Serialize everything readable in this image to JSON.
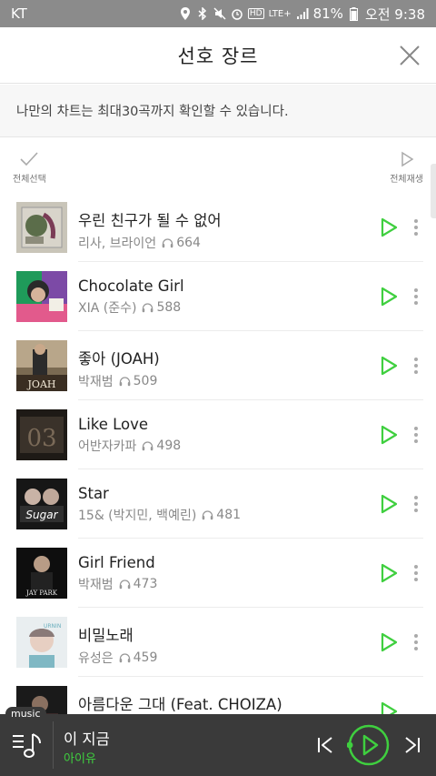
{
  "statusbar": {
    "carrier": "KT",
    "lte": "LTE+",
    "hd": "HD",
    "battery": "81%",
    "time": "오전 9:38"
  },
  "header": {
    "title": "선호 장르"
  },
  "notice": "나만의 차트는 최대30곡까지 확인할 수 있습니다.",
  "actions": {
    "select_all": "전체선택",
    "play_all": "전체재생"
  },
  "songs": [
    {
      "title": "우린 친구가 될 수 없어",
      "artist": "리사, 브라이언",
      "plays": "664"
    },
    {
      "title": "Chocolate Girl",
      "artist": "XIA (준수)",
      "plays": "588"
    },
    {
      "title": "좋아 (JOAH)",
      "artist": "박재범",
      "plays": "509"
    },
    {
      "title": "Like Love",
      "artist": "어반자카파",
      "plays": "498"
    },
    {
      "title": "Star",
      "artist": "15& (박지민, 백예린)",
      "plays": "481"
    },
    {
      "title": "Girl Friend",
      "artist": "박재범",
      "plays": "473"
    },
    {
      "title": "비밀노래",
      "artist": "유성은",
      "plays": "459"
    },
    {
      "title": "아름다운 그대 (Feat. CHOIZA)",
      "artist": "",
      "plays": ""
    }
  ],
  "player": {
    "tag": "music",
    "title": "이 지금",
    "artist": "아이유",
    "accent": "#3fcf3f"
  },
  "colors": {
    "accent": "#3fcf3f",
    "statusbar": "#8b8b8b",
    "player_bg": "#3a3a3a"
  }
}
